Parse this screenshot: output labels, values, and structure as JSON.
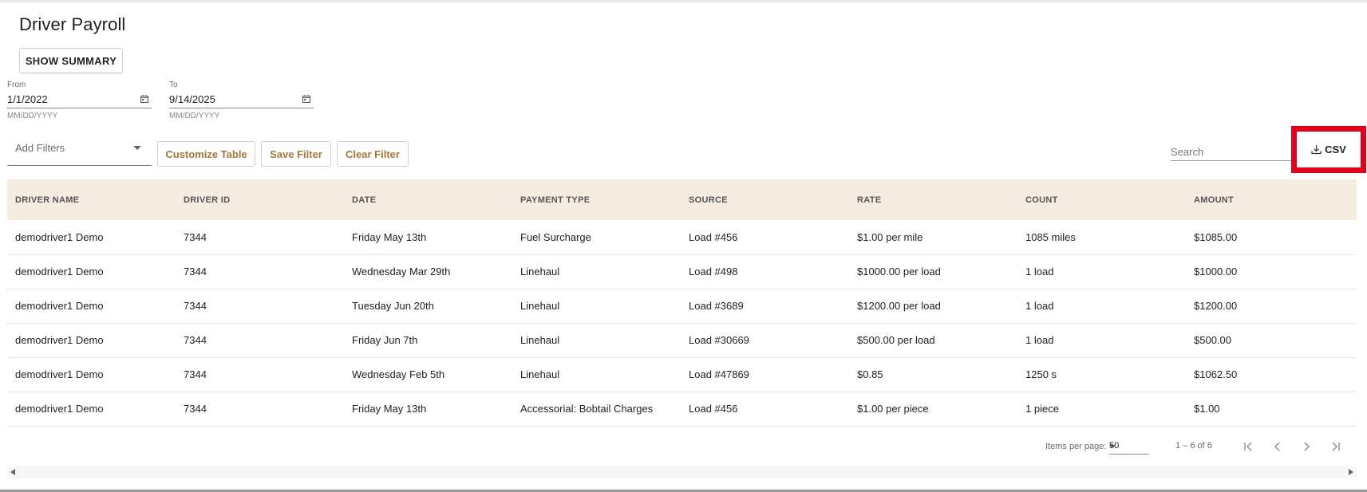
{
  "page": {
    "title": "Driver Payroll"
  },
  "toolbar": {
    "show_summary_label": "SHOW SUMMARY",
    "customize_table_label": "Customize Table",
    "save_filter_label": "Save Filter",
    "clear_filter_label": "Clear Filter",
    "csv_label": "CSV",
    "accent_color": "#a8773a",
    "highlight_color": "#e3001b"
  },
  "date_range": {
    "from": {
      "label": "From",
      "value": "1/1/2022",
      "hint": "MM/DD/YYYY"
    },
    "to": {
      "label": "To",
      "value": "9/14/2025",
      "hint": "MM/DD/YYYY"
    }
  },
  "filters": {
    "placeholder": "Add Filters"
  },
  "search": {
    "placeholder": "Search"
  },
  "table": {
    "header_bg": "#f5ece1",
    "columns": [
      "DRIVER NAME",
      "DRIVER ID",
      "DATE",
      "PAYMENT TYPE",
      "SOURCE",
      "RATE",
      "COUNT",
      "AMOUNT"
    ],
    "rows": [
      [
        "demodriver1 Demo",
        "7344",
        "Friday May 13th",
        "Fuel Surcharge",
        "Load #456",
        "$1.00 per mile",
        "1085 miles",
        "$1085.00"
      ],
      [
        "demodriver1 Demo",
        "7344",
        "Wednesday Mar 29th",
        "Linehaul",
        "Load #498",
        "$1000.00 per load",
        "1 load",
        "$1000.00"
      ],
      [
        "demodriver1 Demo",
        "7344",
        "Tuesday Jun 20th",
        "Linehaul",
        "Load #3689",
        "$1200.00 per load",
        "1 load",
        "$1200.00"
      ],
      [
        "demodriver1 Demo",
        "7344",
        "Friday Jun 7th",
        "Linehaul",
        "Load #30669",
        "$500.00 per load",
        "1 load",
        "$500.00"
      ],
      [
        "demodriver1 Demo",
        "7344",
        "Wednesday Feb 5th",
        "Linehaul",
        "Load #47869",
        "$0.85",
        "1250 s",
        "$1062.50"
      ],
      [
        "demodriver1 Demo",
        "7344",
        "Friday May 13th",
        "Accessorial: Bobtail Charges",
        "Load #456",
        "$1.00 per piece",
        "1 piece",
        "$1.00"
      ]
    ]
  },
  "paginator": {
    "items_per_page_label": "Items per page:",
    "items_per_page_value": "50",
    "range_label": "1 – 6 of 6"
  },
  "icons": {
    "calendar": "calendar-icon",
    "download": "download-icon",
    "first_page": "first-page-icon",
    "prev_page": "chevron-left-icon",
    "next_page": "chevron-right-icon",
    "last_page": "last-page-icon"
  }
}
